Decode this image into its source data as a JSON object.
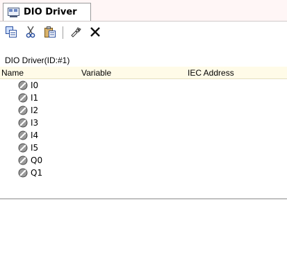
{
  "tab": {
    "label": "DIO Driver",
    "icon": "dio-driver-icon"
  },
  "toolbar": {
    "buttons": [
      {
        "icon": "copy-icon"
      },
      {
        "icon": "cut-icon"
      },
      {
        "icon": "paste-icon"
      },
      {
        "icon": "properties-icon"
      },
      {
        "icon": "delete-icon"
      }
    ]
  },
  "caption": "DIO Driver(ID:#1)",
  "table": {
    "headers": {
      "name": "Name",
      "variable": "Variable",
      "iec": "IEC Address"
    },
    "rows": [
      {
        "name": "I0",
        "variable": "",
        "iec": ""
      },
      {
        "name": "I1",
        "variable": "",
        "iec": ""
      },
      {
        "name": "I2",
        "variable": "",
        "iec": ""
      },
      {
        "name": "I3",
        "variable": "",
        "iec": ""
      },
      {
        "name": "I4",
        "variable": "",
        "iec": ""
      },
      {
        "name": "I5",
        "variable": "",
        "iec": ""
      },
      {
        "name": "Q0",
        "variable": "",
        "iec": ""
      },
      {
        "name": "Q1",
        "variable": "",
        "iec": ""
      }
    ]
  },
  "colors": {
    "tabstrip_bg": "#fff6f6",
    "header_bg": "#fffbe8",
    "io_icon": "#7a7a7a"
  }
}
